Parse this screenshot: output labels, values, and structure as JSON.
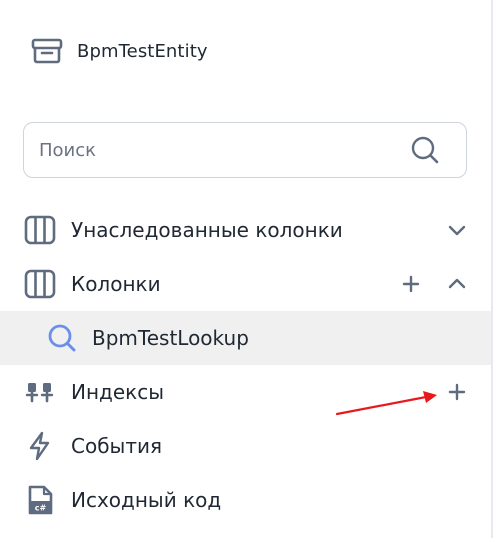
{
  "entity": {
    "title": "BpmTestEntity",
    "icon": "package-box-icon"
  },
  "search": {
    "placeholder": "Поиск",
    "icon": "search-icon"
  },
  "nav": [
    {
      "label": "Унаследованные колонки",
      "icon": "columns-icon",
      "actions": [
        "chevron-down-icon"
      ]
    },
    {
      "label": "Колонки",
      "icon": "columns-icon",
      "actions": [
        "plus-icon",
        "chevron-up-icon"
      ]
    },
    {
      "label": "BpmTestLookup",
      "icon": "search-icon",
      "selected": true
    },
    {
      "label": "Индексы",
      "icon": "index-icon",
      "actions": [
        "plus-icon"
      ]
    },
    {
      "label": "События",
      "icon": "lightning-icon"
    },
    {
      "label": "Исходный код",
      "icon": "csharp-file-icon"
    }
  ],
  "colors": {
    "icon": "#5f6b7e",
    "accent_icon": "#6b8fe8",
    "selected_bg": "#f0f0f0",
    "annotation_arrow": "#e8191c"
  }
}
